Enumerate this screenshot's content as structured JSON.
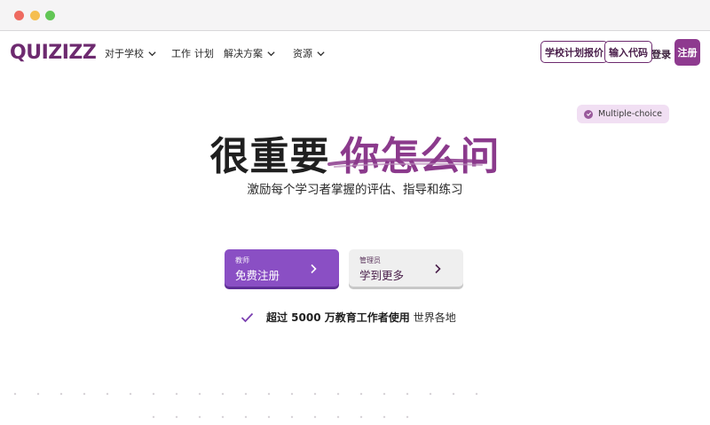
{
  "window": {
    "controls": [
      "close",
      "minimize",
      "maximize"
    ]
  },
  "nav": {
    "logo": "QUIZIZZ",
    "items": [
      {
        "label": "对于学校",
        "has_dropdown": true
      },
      {
        "label": "工作",
        "has_dropdown": false
      },
      {
        "label": "计划",
        "has_dropdown": false
      },
      {
        "label": "解决方案",
        "has_dropdown": true
      },
      {
        "label": "资源",
        "has_dropdown": true
      }
    ],
    "school_pricing": "学校计划报价",
    "enter_code": "输入代码",
    "login": "登录",
    "signup": "注册"
  },
  "hero": {
    "badge": "Multiple-choice",
    "title_main": "很重要",
    "title_highlight": "你怎么问",
    "subtitle": "激励每个学习者掌握的评估、指导和练习",
    "teacher_cta": {
      "small": "教师",
      "main": "免费注册"
    },
    "admin_cta": {
      "small": "管理员",
      "main": "学到更多"
    },
    "proof_bold": "超过 5000 万教育工作者使用",
    "proof_rest": "世界各地"
  },
  "colors": {
    "brand": "#6d2a6f",
    "accent_purple": "#8a4fc4",
    "highlight": "#8b3a8c",
    "badge_bg": "#f1dff3"
  }
}
